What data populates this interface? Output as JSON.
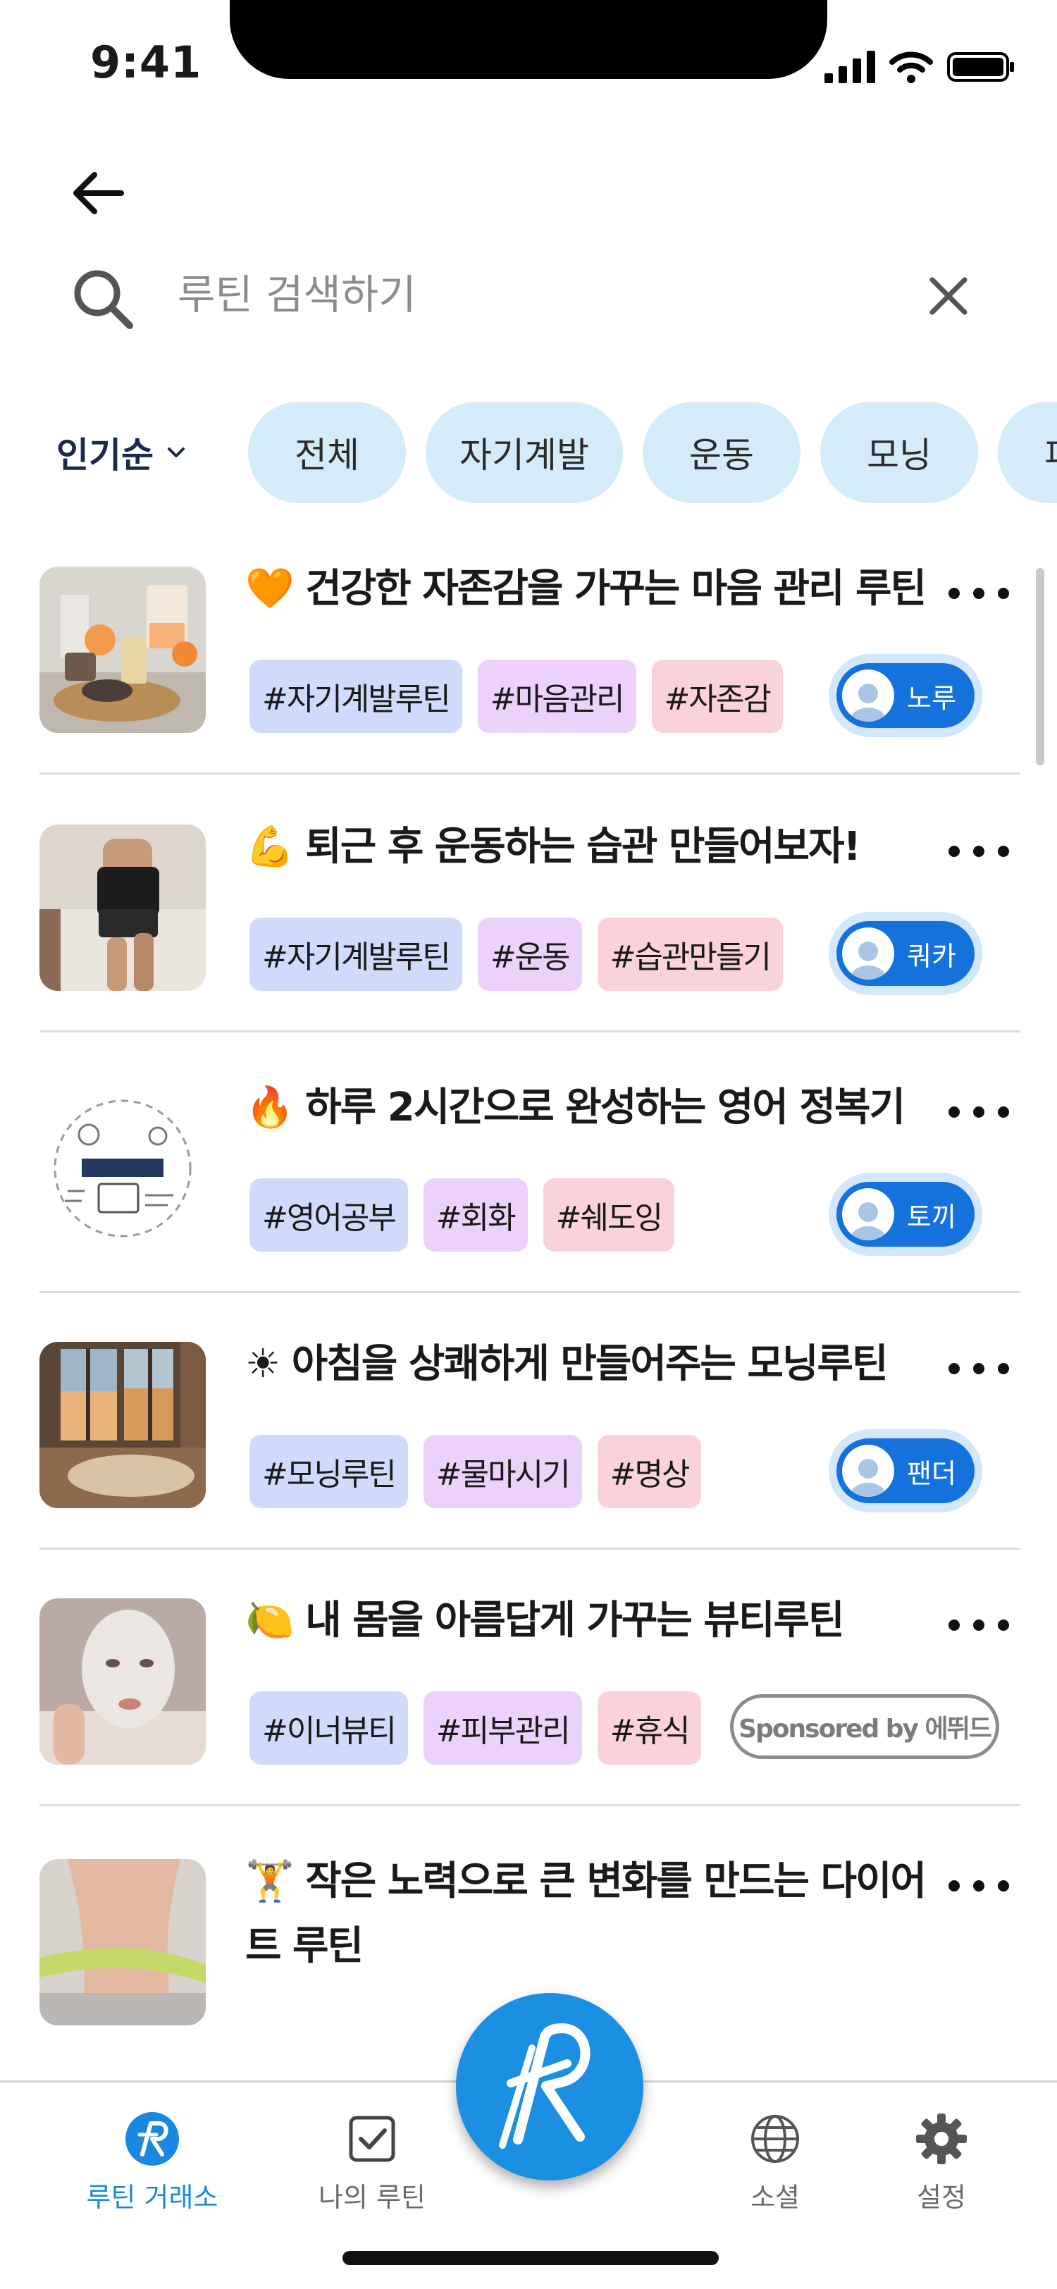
{
  "status": {
    "time": "9:41"
  },
  "search": {
    "placeholder": "루틴 검색하기",
    "value": ""
  },
  "filter": {
    "sort_label": "인기순",
    "chips": [
      "전체",
      "자기계발",
      "운동",
      "모닝",
      "피부"
    ]
  },
  "routines": [
    {
      "emoji": "🧡",
      "title": "건강한 자존감을 가꾸는 마음 관리 루틴",
      "tags": [
        "#자기계발루틴",
        "#마음관리",
        "#자존감"
      ],
      "author": "노루",
      "thumb": "candles-photo"
    },
    {
      "emoji": "💪",
      "title": "퇴근 후 운동하는 습관 만들어보자!",
      "tags": [
        "#자기계발루틴",
        "#운동",
        "#습관만들기"
      ],
      "author": "쿼카",
      "thumb": "running-photo"
    },
    {
      "emoji": "🔥",
      "title": "하루 2시간으로 완성하는 영어 정복기",
      "tags": [
        "#영어공부",
        "#회화",
        "#쉐도잉"
      ],
      "author": "토끼",
      "thumb": "english-doodle"
    },
    {
      "emoji": "☀",
      "title": "아침을 상쾌하게 만들어주는 모닝루틴",
      "tags": [
        "#모닝루틴",
        "#물마시기",
        "#명상"
      ],
      "author": "팬더",
      "thumb": "morning-window-photo"
    },
    {
      "emoji": "🍋",
      "title": "내 몸을 아름답게 가꾸는 뷰티루틴",
      "tags": [
        "#이너뷰티",
        "#피부관리",
        "#휴식"
      ],
      "sponsor": "Sponsored by 에뛰드",
      "thumb": "face-mask-photo"
    },
    {
      "emoji": "🏋",
      "title": "작은 노력으로 큰 변화를 만드는 다이어트 루틴",
      "thumb": "diet-waist-photo"
    }
  ],
  "tab_bar": {
    "tabs": [
      {
        "label": "루틴 거래소",
        "icon": "routine-exchange-icon",
        "active": true
      },
      {
        "label": "나의 루틴",
        "icon": "checkbox-icon",
        "active": false
      },
      {
        "label": "소셜",
        "icon": "globe-icon",
        "active": false
      },
      {
        "label": "설정",
        "icon": "gear-icon",
        "active": false
      }
    ],
    "fab_icon": "routine-logo-icon"
  },
  "colors": {
    "accent": "#1a88e0",
    "chip_bg": "#d4ecfa",
    "author_pill": "#1572dc"
  }
}
